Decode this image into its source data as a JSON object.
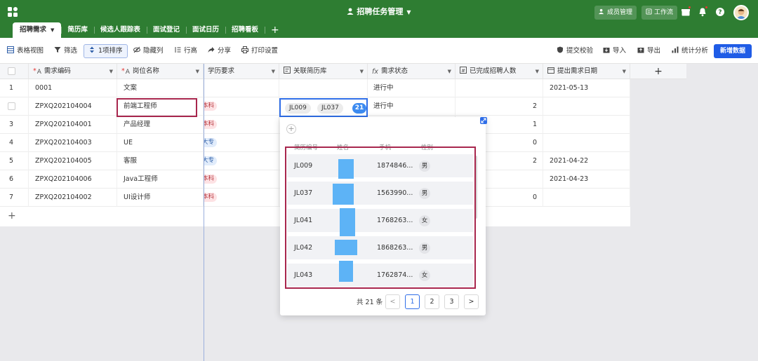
{
  "header": {
    "title": "招聘任务管理",
    "members_label": "成员管理",
    "workflow_label": "工作流"
  },
  "tabs": [
    {
      "label": "招聘需求",
      "active": true
    },
    {
      "label": "简历库"
    },
    {
      "label": "候选人跟踪表"
    },
    {
      "label": "面试登记"
    },
    {
      "label": "面试日历"
    },
    {
      "label": "招聘看板"
    }
  ],
  "toolbar": {
    "table_view": "表格视图",
    "filter": "筛选",
    "sort": "1项排序",
    "hide_cols": "隐藏列",
    "row_height": "行高",
    "share": "分享",
    "print": "打印设置",
    "submit_check": "提交校验",
    "import": "导入",
    "export": "导出",
    "stats": "统计分析",
    "new_data": "新增数据"
  },
  "columns": [
    "需求编码",
    "岗位名称",
    "学历要求",
    "关联简历库",
    "需求状态",
    "已完成招聘人数",
    "提出需求日期"
  ],
  "rows": [
    {
      "idx": "1",
      "code": "0001",
      "position": "文案",
      "edu": "",
      "status": "进行中",
      "done": "",
      "date": "2021-05-13"
    },
    {
      "idx": "",
      "code": "ZPXQ202104004",
      "position": "前端工程师",
      "edu": "本科",
      "status": "进行中",
      "done": "2",
      "date": ""
    },
    {
      "idx": "3",
      "code": "ZPXQ202104001",
      "position": "产品经理",
      "edu": "本科",
      "status": "",
      "done": "1",
      "date": ""
    },
    {
      "idx": "4",
      "code": "ZPXQ202104003",
      "position": "UE",
      "edu": "大专",
      "status": "",
      "done": "0",
      "date": ""
    },
    {
      "idx": "5",
      "code": "ZPXQ202104005",
      "position": "客服",
      "edu": "大专",
      "status": "",
      "done": "2",
      "date": "2021-04-22"
    },
    {
      "idx": "6",
      "code": "ZPXQ202104006",
      "position": "Java工程师",
      "edu": "本科",
      "status": "",
      "done": "",
      "date": "2021-04-23"
    },
    {
      "idx": "7",
      "code": "ZPXQ202104002",
      "position": "UI设计师",
      "edu": "本科",
      "status": "",
      "done": "0",
      "date": ""
    }
  ],
  "linked": {
    "tags": [
      "JL009",
      "JL037"
    ],
    "count": "21"
  },
  "popup": {
    "headers": [
      "简历编号",
      "姓名",
      "手机",
      "性别"
    ],
    "rows": [
      {
        "id": "JL009",
        "phone": "1874846...",
        "gender": "男"
      },
      {
        "id": "JL037",
        "phone": "1563990...",
        "gender": "男"
      },
      {
        "id": "JL041",
        "phone": "1768263...",
        "gender": "女"
      },
      {
        "id": "JL042",
        "phone": "1868263...",
        "gender": "男"
      },
      {
        "id": "JL043",
        "phone": "1762874...",
        "gender": "女"
      }
    ],
    "total": "共 21 条",
    "pages": [
      "1",
      "2",
      "3"
    ],
    "prev": "<",
    "next": ">"
  },
  "icons": {
    "add": "+"
  }
}
